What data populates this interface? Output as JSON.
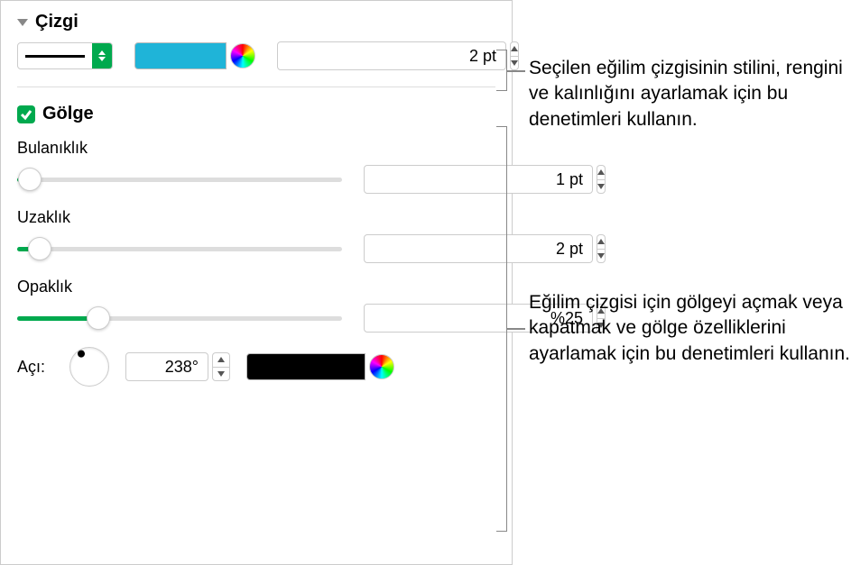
{
  "line": {
    "title": "Çizgi",
    "stroke_color": "#1fb4d8",
    "thickness_value": "2 pt"
  },
  "shadow": {
    "title": "Gölge",
    "checked": true,
    "blur": {
      "label": "Bulanıklık",
      "value": "1 pt",
      "percent": 4
    },
    "offset": {
      "label": "Uzaklık",
      "value": "2 pt",
      "percent": 7
    },
    "opacity": {
      "label": "Opaklık",
      "value": "%25",
      "percent": 25
    },
    "angle": {
      "label": "Açı:",
      "value": "238°",
      "deg": 238
    },
    "color": "#000000"
  },
  "annotations": {
    "line_help": "Seçilen eğilim çizgisinin stilini, rengini ve kalınlığını ayarlamak için bu denetimleri kullanın.",
    "shadow_help": "Eğilim çizgisi için gölgeyi açmak veya kapatmak ve gölge özelliklerini ayarlamak için bu denetimleri kullanın."
  }
}
